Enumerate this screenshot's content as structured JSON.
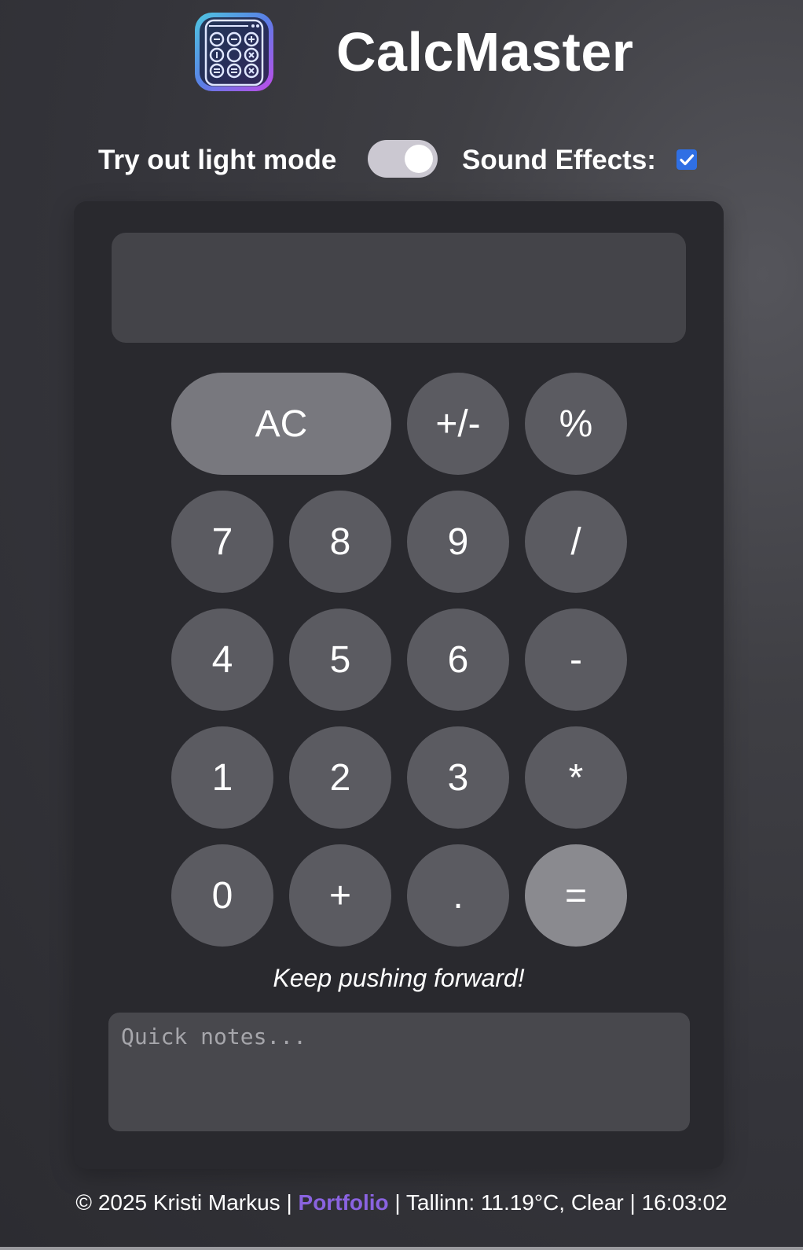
{
  "app": {
    "title": "CalcMaster",
    "logo_icon": "calculator-app-icon"
  },
  "settings": {
    "light_mode_label": "Try out light mode",
    "light_mode_toggle_on": false,
    "sound_label": "Sound Effects:",
    "sound_checked": true
  },
  "display": {
    "value": ""
  },
  "keys": {
    "ac": "AC",
    "plus_minus": "+/-",
    "percent": "%",
    "seven": "7",
    "eight": "8",
    "nine": "9",
    "divide": "/",
    "four": "4",
    "five": "5",
    "six": "6",
    "minus": "-",
    "one": "1",
    "two": "2",
    "three": "3",
    "multiply": "*",
    "zero": "0",
    "plus": "+",
    "decimal": ".",
    "equals": "="
  },
  "motto": "Keep pushing forward!",
  "notes": {
    "placeholder": "Quick notes...",
    "value": ""
  },
  "footer": {
    "copyright": "© 2025 Kristi Markus | ",
    "portfolio_link": "Portfolio",
    "weather": " | Tallinn: 11.19°C, Clear | ",
    "time": "16:03:02"
  },
  "colors": {
    "accent_link": "#8a63e0",
    "checkbox": "#2f6fe4"
  }
}
